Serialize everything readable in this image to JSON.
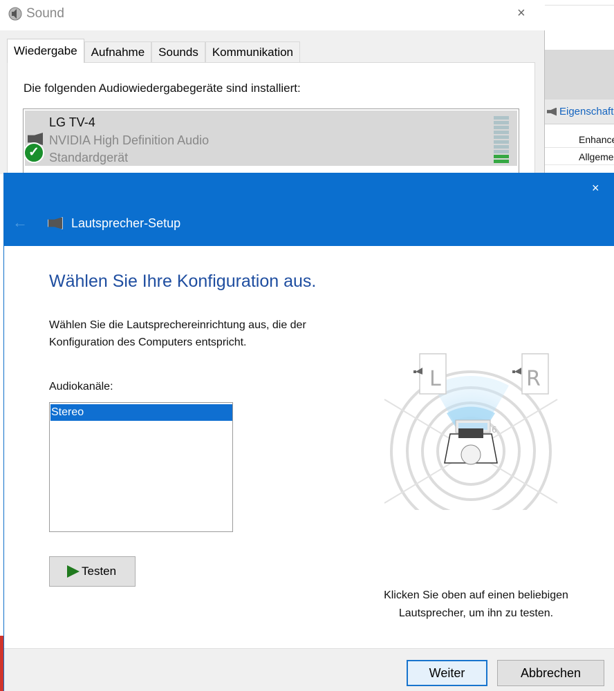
{
  "sound_dialog": {
    "title": "Sound",
    "close_label": "×",
    "tabs": [
      {
        "label": "Wiedergabe",
        "active": true
      },
      {
        "label": "Aufnahme",
        "active": false
      },
      {
        "label": "Sounds",
        "active": false
      },
      {
        "label": "Kommunikation",
        "active": false
      }
    ],
    "caption": "Die folgenden Audiowiedergabegeräte sind installiert:",
    "device": {
      "name": "LG TV-4",
      "driver": "NVIDIA High Definition Audio",
      "status": "Standardgerät",
      "icon": "speaker-icon",
      "status_icon": "default-check-icon",
      "level_segments": 10,
      "level_active_segments": 2
    }
  },
  "background_app": {
    "properties_label": "Eigenschaft",
    "rows": [
      "Enhance",
      "Allgemei"
    ]
  },
  "wizard": {
    "title": "Lautsprecher-Setup",
    "close_label": "×",
    "back_label": "←",
    "heading": "Wählen Sie Ihre Konfiguration aus.",
    "description": "Wählen Sie die Lautsprechereinrichtung aus, die der Konfiguration des Computers entspricht.",
    "channels_label": "Audiokanäle:",
    "channels": [
      {
        "label": "Stereo",
        "selected": true
      }
    ],
    "test_button": "Testen",
    "speakers": {
      "left": "L",
      "right": "R"
    },
    "hint": "Klicken Sie oben auf einen beliebigen Lautsprecher, um ihn zu testen.",
    "next_button": "Weiter",
    "cancel_button": "Abbrechen"
  },
  "colors": {
    "accent": "#0b6fcf",
    "heading": "#1f4ea0",
    "selection": "#0f6fd1",
    "check_green": "#1a8f2c",
    "play_green": "#207a1e"
  }
}
